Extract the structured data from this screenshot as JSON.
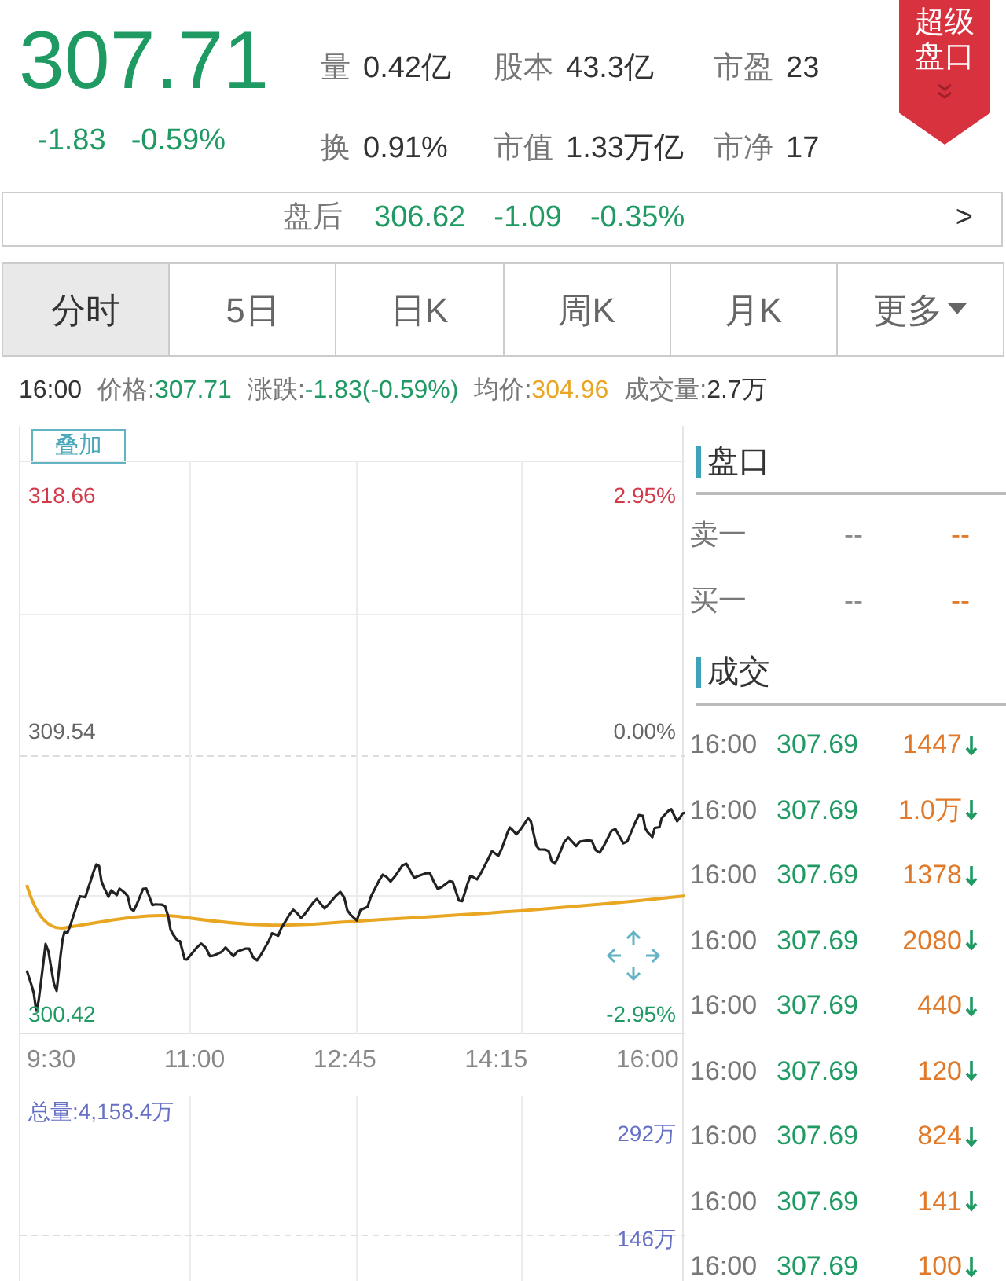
{
  "quote": {
    "price": "307.71",
    "change": "-1.83",
    "change_pct": "-0.59%",
    "stats": [
      {
        "label": "量",
        "value": "0.42亿"
      },
      {
        "label": "股本",
        "value": "43.3亿"
      },
      {
        "label": "市盈",
        "value": "23"
      },
      {
        "label": "换",
        "value": "0.91%"
      },
      {
        "label": "市值",
        "value": "1.33万亿"
      },
      {
        "label": "市净",
        "value": "17"
      }
    ]
  },
  "super_panel_badge": {
    "lines": [
      "超级",
      "盘口"
    ]
  },
  "after_hours": {
    "label": "盘后",
    "price": "306.62",
    "change": "-1.09",
    "change_pct": "-0.35%",
    "arrow": ">"
  },
  "tabs": [
    {
      "label": "分时",
      "selected": true,
      "kind": "tab"
    },
    {
      "label": "5日",
      "selected": false,
      "kind": "tab"
    },
    {
      "label": "日K",
      "selected": false,
      "kind": "tab"
    },
    {
      "label": "周K",
      "selected": false,
      "kind": "tab"
    },
    {
      "label": "月K",
      "selected": false,
      "kind": "tab"
    },
    {
      "label": "更多",
      "selected": false,
      "kind": "menu"
    }
  ],
  "info_line": {
    "time": "16:00",
    "items": [
      {
        "label": "价格:",
        "value": "307.71",
        "color": "#1f9a63"
      },
      {
        "label": "涨跌:",
        "value": "-1.83(-0.59%)",
        "color": "#1f9a63"
      },
      {
        "label": "均价:",
        "value": "304.96",
        "color": "#e8a623"
      },
      {
        "label": "成交量:",
        "value": "2.7万",
        "color": "#333333"
      }
    ]
  },
  "chart": {
    "overlay_button": "叠加",
    "high": "318.66",
    "high_pct": "2.95%",
    "base": "309.54",
    "base_pct": "0.00%",
    "low": "300.42",
    "low_pct": "-2.95%",
    "time_labels": [
      "9:30",
      "11:00",
      "12:45",
      "14:15",
      "16:00"
    ],
    "volume_total": "总量:4,158.4万",
    "volume_ticks": [
      "292万",
      "146万"
    ]
  },
  "order_book": {
    "title": "盘口",
    "rows": [
      {
        "label": "卖一",
        "price": "--",
        "volume": "--"
      },
      {
        "label": "买一",
        "price": "--",
        "volume": "--"
      }
    ]
  },
  "trades": {
    "title": "成交",
    "rows": [
      {
        "time": "16:00",
        "price": "307.69",
        "volume": "1447",
        "kind": "down"
      },
      {
        "time": "16:00",
        "price": "307.69",
        "volume": "1.0万",
        "kind": "down"
      },
      {
        "time": "16:00",
        "price": "307.69",
        "volume": "1378",
        "kind": "down"
      },
      {
        "time": "16:00",
        "price": "307.69",
        "volume": "2080",
        "kind": "down"
      },
      {
        "time": "16:00",
        "price": "307.69",
        "volume": "440",
        "kind": "down"
      },
      {
        "time": "16:00",
        "price": "307.69",
        "volume": "120",
        "kind": "down"
      },
      {
        "time": "16:00",
        "price": "307.69",
        "volume": "824",
        "kind": "down"
      },
      {
        "time": "16:00",
        "price": "307.69",
        "volume": "141",
        "kind": "down"
      },
      {
        "time": "16:00",
        "price": "307.69",
        "volume": "100",
        "kind": "down"
      }
    ]
  }
}
